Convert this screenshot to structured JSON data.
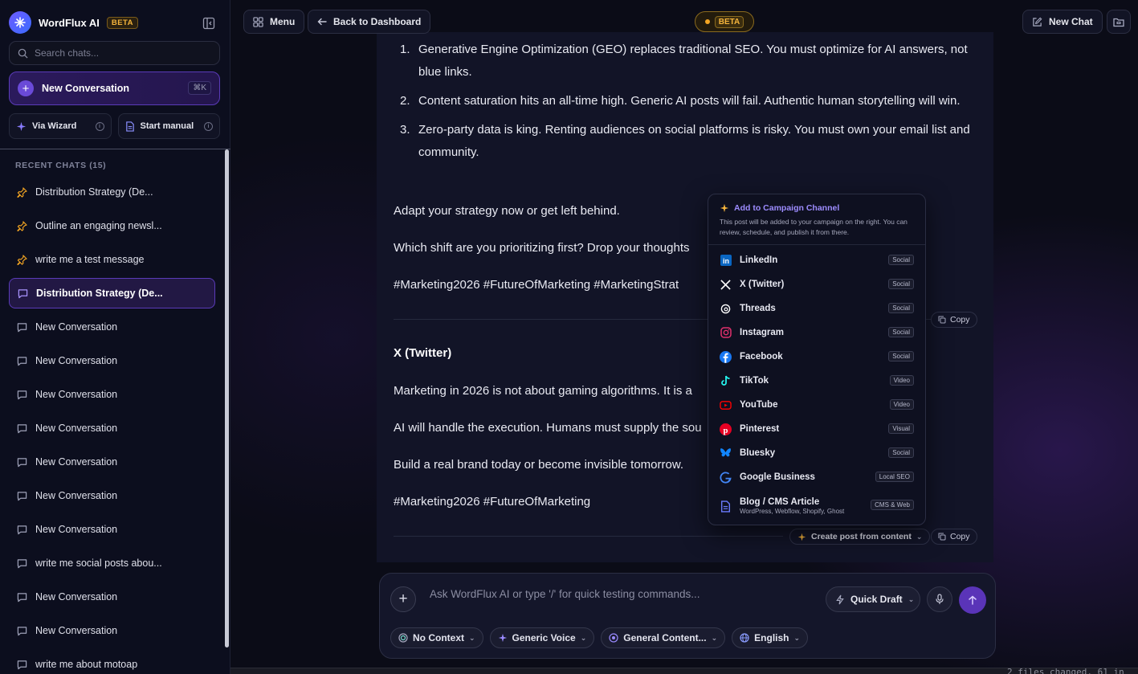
{
  "app": {
    "name": "WordFlux AI",
    "beta_label": "BETA"
  },
  "sidebar": {
    "search_placeholder": "Search chats...",
    "new_conversation": {
      "label": "New Conversation",
      "shortcut": "⌘K"
    },
    "via_wizard": "Via Wizard",
    "start_manual": "Start manual",
    "recent_heading": "RECENT CHATS (15)",
    "chats": [
      {
        "label": "Distribution Strategy (De...",
        "pinned": true,
        "active": false
      },
      {
        "label": "Outline an engaging newsl...",
        "pinned": true,
        "active": false
      },
      {
        "label": "write me a test message",
        "pinned": true,
        "active": false
      },
      {
        "label": "Distribution Strategy (De...",
        "pinned": false,
        "active": true
      },
      {
        "label": "New Conversation",
        "pinned": false,
        "active": false
      },
      {
        "label": "New Conversation",
        "pinned": false,
        "active": false
      },
      {
        "label": "New Conversation",
        "pinned": false,
        "active": false
      },
      {
        "label": "New Conversation",
        "pinned": false,
        "active": false
      },
      {
        "label": "New Conversation",
        "pinned": false,
        "active": false
      },
      {
        "label": "New Conversation",
        "pinned": false,
        "active": false
      },
      {
        "label": "New Conversation",
        "pinned": false,
        "active": false
      },
      {
        "label": "write me social posts abou...",
        "pinned": false,
        "active": false
      },
      {
        "label": "New Conversation",
        "pinned": false,
        "active": false
      },
      {
        "label": "New Conversation",
        "pinned": false,
        "active": false
      },
      {
        "label": "write me about motoap",
        "pinned": false,
        "active": false
      }
    ]
  },
  "topbar": {
    "menu": "Menu",
    "back": "Back to Dashboard",
    "beta": "BETA",
    "new_chat": "New Chat"
  },
  "content": {
    "list_items": [
      {
        "num": "1.",
        "text": "Generative Engine Optimization (GEO) replaces traditional SEO. You must optimize for AI answers, not blue links."
      },
      {
        "num": "2.",
        "text": "Content saturation hits an all-time high. Generic AI posts will fail. Authentic human storytelling will win."
      },
      {
        "num": "3.",
        "text": "Zero-party data is king. Renting audiences on social platforms is risky. You must own your email list and community."
      }
    ],
    "p_adapt": "Adapt your strategy now or get left behind.",
    "p_which": "Which shift are you prioritizing first? Drop your thoughts",
    "p_hashtags1": "#Marketing2026 #FutureOfMarketing #MarketingStrat",
    "copy": "Copy",
    "section_twitter": "X (Twitter)",
    "p_tw1": "Marketing in 2026 is not about gaming algorithms. It is a",
    "p_tw2": "AI will handle the execution. Humans must supply the sou",
    "p_tw3": "Build a real brand today or become invisible tomorrow.",
    "p_tw4": "#Marketing2026 #FutureOfMarketing",
    "create_post": "Create post from content"
  },
  "popup": {
    "title": "Add to Campaign Channel",
    "subtitle": "This post will be added to your campaign on the right. You can review, schedule, and publish it from there.",
    "channels": [
      {
        "name": "LinkedIn",
        "tag": "Social",
        "icon": "linkedin-icon",
        "color": "#0a66c2"
      },
      {
        "name": "X (Twitter)",
        "tag": "Social",
        "icon": "x-icon",
        "color": "#ffffff"
      },
      {
        "name": "Threads",
        "tag": "Social",
        "icon": "threads-icon",
        "color": "#ffffff"
      },
      {
        "name": "Instagram",
        "tag": "Social",
        "icon": "instagram-icon",
        "color": "#e1306c"
      },
      {
        "name": "Facebook",
        "tag": "Social",
        "icon": "facebook-icon",
        "color": "#1877f2"
      },
      {
        "name": "TikTok",
        "tag": "Video",
        "icon": "tiktok-icon",
        "color": "#25f4ee"
      },
      {
        "name": "YouTube",
        "tag": "Video",
        "icon": "youtube-icon",
        "color": "#ff0000"
      },
      {
        "name": "Pinterest",
        "tag": "Visual",
        "icon": "pinterest-icon",
        "color": "#e60023"
      },
      {
        "name": "Bluesky",
        "tag": "Social",
        "icon": "bluesky-icon",
        "color": "#1185fe"
      },
      {
        "name": "Google Business",
        "tag": "Local SEO",
        "icon": "google-icon",
        "color": "#4285f4"
      },
      {
        "name": "Blog / CMS Article",
        "tag": "CMS & Web",
        "icon": "document-icon",
        "color": "#6c7bff",
        "sub": "WordPress, Webflow, Shopify, Ghost"
      }
    ]
  },
  "composer": {
    "placeholder": "Ask WordFlux AI or type '/' for quick testing commands...",
    "mode": "Quick Draft",
    "chips": [
      {
        "label": "No Context",
        "icon": "context-icon"
      },
      {
        "label": "Generic Voice",
        "icon": "sparkle-icon"
      },
      {
        "label": "General Content...",
        "icon": "content-icon"
      },
      {
        "label": "English",
        "icon": "globe-icon"
      }
    ]
  },
  "terminal": {
    "status": "2 files changed, 61 in"
  }
}
